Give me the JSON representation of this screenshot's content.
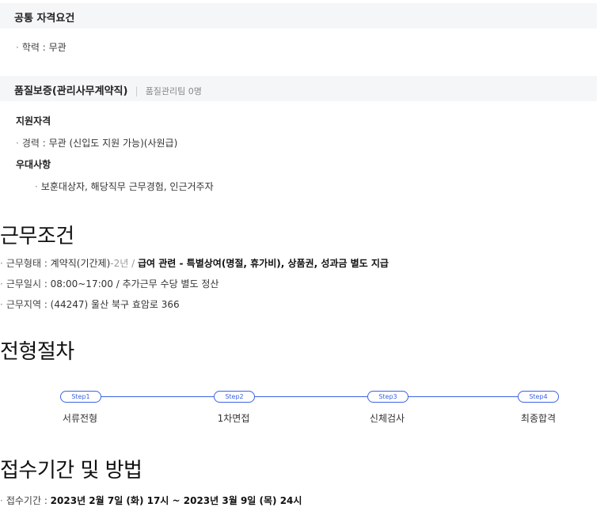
{
  "common": {
    "title": "공통 자격요건",
    "education_label": "학력",
    "education_value": "무관"
  },
  "position": {
    "title": "품질보증(관리사무계약직)",
    "separator": "|",
    "team": "품질관리팀 0명",
    "qualification_head": "지원자격",
    "career_label": "경력",
    "career_value": "무관 (신입도 지원 가능)(사원급)",
    "preference_head": "우대사항",
    "preference_value": "보훈대상자, 해당직무 근무경험, 인근거주자"
  },
  "conditions": {
    "title": "근무조건",
    "type_label": "근무형태",
    "type_value": "계약직(기간제)",
    "type_period": "-2년",
    "type_slash": "/",
    "salary_text": "급여 관련 - 특별상여(명절, 휴가비), 상품권, 성과금 별도 지급",
    "hours_label": "근무일시",
    "hours_value": "08:00~17:00 / 추가근무 수당 별도 정산",
    "location_label": "근무지역",
    "location_value": "(44247) 울산 북구 효암로 366"
  },
  "process": {
    "title": "전형절차",
    "steps": [
      {
        "badge": "Step1",
        "label": "서류전형"
      },
      {
        "badge": "Step2",
        "label": "1차면접"
      },
      {
        "badge": "Step3",
        "label": "신체검사"
      },
      {
        "badge": "Step4",
        "label": "최종합격"
      }
    ]
  },
  "application": {
    "title": "접수기간 및 방법",
    "period_label": "접수기간",
    "period_value": "2023년 2월 7일 (화) 17시 ~ 2023년 3월 9일 (목) 24시"
  },
  "colors": {
    "accent": "#3b63e0",
    "bar_bg": "#f5f6f8"
  }
}
